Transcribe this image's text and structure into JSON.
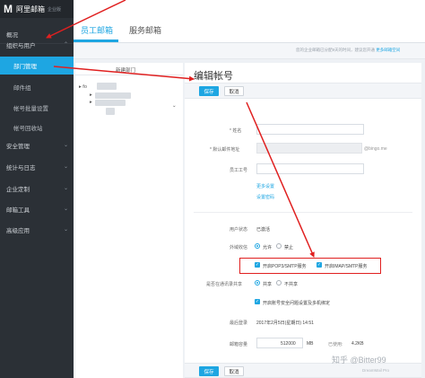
{
  "app": {
    "logo_mark": "M",
    "name": "阿里邮箱",
    "edition": "企业版"
  },
  "sidebar": {
    "items": [
      {
        "label": "概况"
      },
      {
        "label": "组织与用户"
      },
      {
        "label": "部门管理"
      },
      {
        "label": "邮件组"
      },
      {
        "label": "帐号批量设置"
      },
      {
        "label": "帐号回收站"
      },
      {
        "label": "安全管理"
      },
      {
        "label": "统计与日志"
      },
      {
        "label": "企业定制"
      },
      {
        "label": "邮箱工具"
      },
      {
        "label": "高级应用"
      }
    ]
  },
  "tabs": [
    {
      "label": "员工邮箱"
    },
    {
      "label": "服务邮箱"
    }
  ],
  "notice": {
    "text": "您的企业邮箱已分配9天的时间，建议您开通",
    "link": "更多邮箱空间"
  },
  "tree": {
    "header": "新建部门",
    "root": "fo"
  },
  "editor": {
    "title": "编辑帐号",
    "save_label": "保存",
    "cancel_label": "取消",
    "fields": {
      "name_label": "* 姓名",
      "mailbox_label": "* 默认邮件地址",
      "domain_suffix": "@bingo.me",
      "employee_no_label": "员工工号",
      "more_settings": "更多设置",
      "more_numbers": "设置密码",
      "status_label": "用户状态",
      "status_value": "已激活",
      "external_label": "外域收信",
      "allow": "允许",
      "deny": "禁止",
      "pop3_smtp": "开启POP3/SMTP服务",
      "imap_smtp": "开启IMAP/SMTP服务",
      "directory_label": "是否在通讯录共享",
      "share": "共享",
      "no_share": "不共享",
      "security_setting": "开启账号安全问题设置及多机绑定",
      "last_login_label": "最后登录",
      "last_login_value": "2017年2月5日(星期日) 14:51",
      "capacity_label": "邮箱容量",
      "capacity_value": "512000",
      "capacity_unit": "MB",
      "used_label": "已使用:",
      "used_value": "4.2KB"
    }
  },
  "watermark": {
    "text": "知乎 @Bitter99",
    "sub": "DreamMail Pro"
  },
  "colors": {
    "accent": "#1ea6e2",
    "sidebar_bg": "#2b3036",
    "highlight": "#e02020"
  }
}
